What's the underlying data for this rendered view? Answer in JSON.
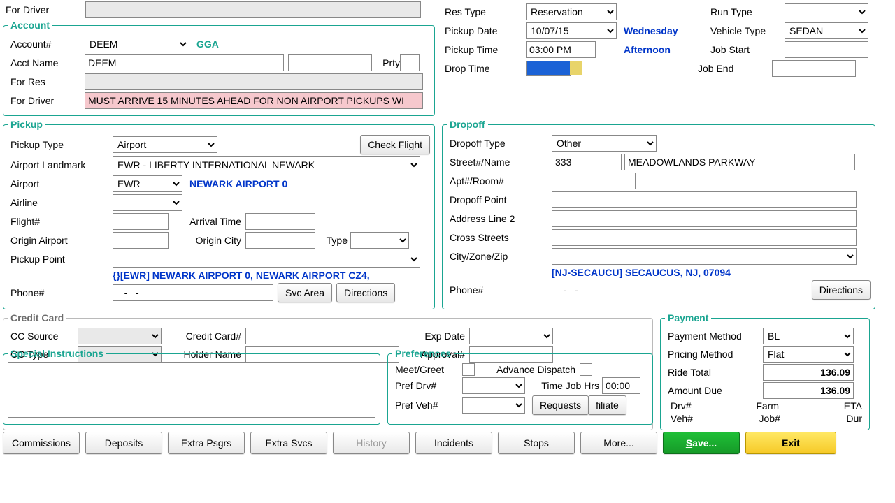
{
  "top": {
    "for_driver_label": "For Driver",
    "res_type_label": "Res Type",
    "res_type": "Reservation",
    "run_type_label": "Run Type",
    "run_type": "",
    "pickup_date_label": "Pickup Date",
    "pickup_date": "10/07/15",
    "day_name": "Wednesday",
    "day_part": "Afternoon",
    "vehicle_type_label": "Vehicle Type",
    "vehicle_type": "SEDAN",
    "pickup_time_label": "Pickup Time",
    "pickup_time": "03:00 PM",
    "job_start_label": "Job Start",
    "job_start": "",
    "drop_time_label": "Drop Time",
    "job_end_label": "Job End",
    "job_end": ""
  },
  "account": {
    "legend": "Account",
    "account_no_label": "Account#",
    "account_no": "DEEM",
    "account_code": "GGA",
    "acct_name_label": "Acct Name",
    "acct_name": "DEEM",
    "prty_label": "Prty",
    "for_res_label": "For Res",
    "for_driver_label": "For Driver",
    "for_driver_note": "MUST ARRIVE 15 MINUTES AHEAD FOR NON AIRPORT PICKUPS WI"
  },
  "pickup": {
    "legend": "Pickup",
    "type_label": "Pickup Type",
    "type": "Airport",
    "check_flight": "Check Flight",
    "landmark_label": "Airport Landmark",
    "landmark": "EWR - LIBERTY INTERNATIONAL NEWARK",
    "airport_label": "Airport",
    "airport": "EWR",
    "airport_note": "NEWARK AIRPORT 0",
    "airline_label": "Airline",
    "airline": "",
    "flight_label": "Flight#",
    "flight": "",
    "arrival_label": "Arrival Time",
    "arrival": "",
    "origin_airport_label": "Origin Airport",
    "origin_airport": "",
    "origin_city_label": "Origin City",
    "origin_city": "",
    "origin_type_label": "Type",
    "origin_type": "",
    "pickup_point_label": "Pickup Point",
    "pickup_point": "",
    "address_line": "{}[EWR] NEWARK AIRPORT 0, NEWARK AIRPORT CZ4,",
    "phone_label": "Phone#",
    "phone": "   -   -",
    "svc_area": "Svc Area",
    "directions": "Directions"
  },
  "dropoff": {
    "legend": "Dropoff",
    "type_label": "Dropoff Type",
    "type": "Other",
    "street_label": "Street#/Name",
    "street_no": "333",
    "street_name": "MEADOWLANDS PARKWAY",
    "apt_label": "Apt#/Room#",
    "apt": "",
    "point_label": "Dropoff Point",
    "point": "",
    "addr2_label": "Address Line 2",
    "addr2": "",
    "cross_label": "Cross Streets",
    "cross": "",
    "czz_label": "City/Zone/Zip",
    "czz": "",
    "address_line": "[NJ-SECAUCU] SECAUCUS, NJ, 07094",
    "phone_label": "Phone#",
    "phone": "   -   -",
    "directions": "Directions"
  },
  "cc": {
    "legend": "Credit Card",
    "source_label": "CC Source",
    "source": "",
    "number_label": "Credit Card#",
    "number": "",
    "exp_label": "Exp Date",
    "exp": "",
    "type_label": "CC Type",
    "type": "",
    "holder_label": "Holder Name",
    "holder": "",
    "approval_label": "Approval#",
    "approval": ""
  },
  "si": {
    "legend": "Special Instructions",
    "text": ""
  },
  "pref": {
    "legend": "Preferences",
    "meet_label": "Meet/Greet",
    "adv_label": "Advance Dispatch",
    "pref_drv_label": "Pref Drv#",
    "pref_drv": "",
    "time_job_label": "Time Job Hrs",
    "time_job": "00:00",
    "pref_veh_label": "Pref Veh#",
    "pref_veh": "",
    "requests": "Requests",
    "filiate": "filiate"
  },
  "pay": {
    "legend": "Payment",
    "method_label": "Payment Method",
    "method": "BL",
    "pricing_label": "Pricing Method",
    "pricing": "Flat",
    "ride_total_label": "Ride Total",
    "ride_total": "136.09",
    "amount_due_label": "Amount Due",
    "amount_due": "136.09",
    "drv_label": "Drv#",
    "farm_label": "Farm",
    "eta_label": "ETA",
    "veh_label": "Veh#",
    "job_label": "Job#",
    "dur_label": "Dur"
  },
  "buttons": {
    "commissions": "Commissions",
    "deposits": "Deposits",
    "extra_psgrs": "Extra Psgrs",
    "extra_svcs": "Extra Svcs",
    "history": "History",
    "incidents": "Incidents",
    "stops": "Stops",
    "more": "More...",
    "save": "Save...",
    "exit": "Exit"
  }
}
